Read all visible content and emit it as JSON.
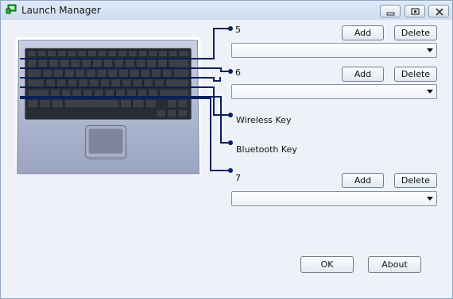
{
  "window": {
    "title": "Launch Manager",
    "controls": [
      "minimize-icon",
      "maximize-icon",
      "close-icon"
    ]
  },
  "keys": [
    {
      "label": "5",
      "add_label": "Add",
      "delete_label": "Delete",
      "selected": ""
    },
    {
      "label": "6",
      "add_label": "Add",
      "delete_label": "Delete",
      "selected": ""
    },
    {
      "label": "Wireless Key"
    },
    {
      "label": "Bluetooth Key"
    },
    {
      "label": "7",
      "add_label": "Add",
      "delete_label": "Delete",
      "selected": ""
    }
  ],
  "footer": {
    "ok_label": "OK",
    "about_label": "About"
  },
  "colors": {
    "connector": "#0a1f5c",
    "titlebar": "#dfe9f6"
  }
}
